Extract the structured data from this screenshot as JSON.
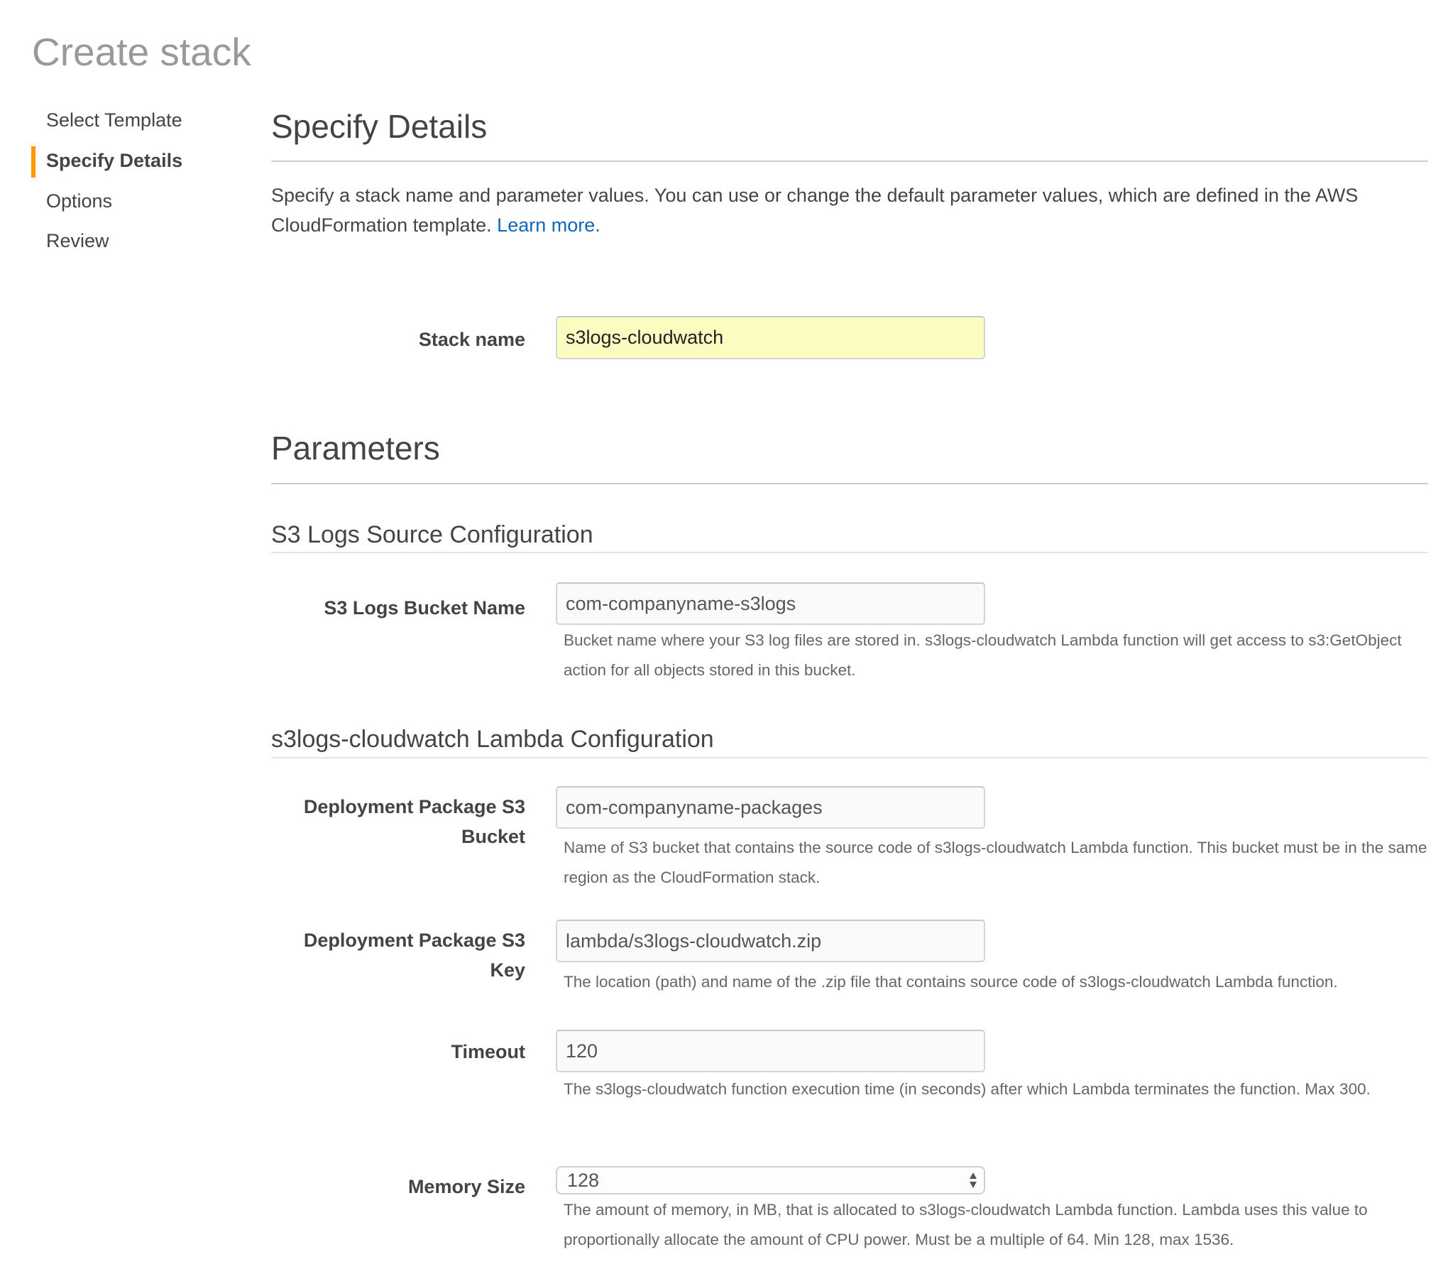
{
  "page": {
    "title": "Create stack"
  },
  "sidebar": {
    "items": [
      {
        "label": "Select Template",
        "active": false
      },
      {
        "label": "Specify Details",
        "active": true
      },
      {
        "label": "Options",
        "active": false
      },
      {
        "label": "Review",
        "active": false
      }
    ],
    "accent_color": "#ff9900"
  },
  "details": {
    "heading": "Specify Details",
    "intro": "Specify a stack name and parameter values. You can use or change the default parameter values, which are defined in the AWS CloudFormation template.",
    "learn_more": "Learn more.",
    "link_color": "#1166bb"
  },
  "stack": {
    "label": "Stack name",
    "value": "s3logs-cloudwatch"
  },
  "parameters": {
    "heading": "Parameters",
    "groups": [
      {
        "heading": "S3 Logs Source Configuration",
        "fields": [
          {
            "label": "S3 Logs Bucket Name",
            "value": "com-companyname-s3logs",
            "help": "Bucket name where your S3 log files are stored in. s3logs-cloudwatch Lambda function will get access to s3:GetObject action for all objects stored in this bucket."
          }
        ]
      },
      {
        "heading": "s3logs-cloudwatch Lambda Configuration",
        "fields": [
          {
            "label": "Deployment Package S3 Bucket",
            "value": "com-companyname-packages",
            "help": "Name of S3 bucket that contains the source code of s3logs-cloudwatch Lambda function. This bucket must be in the same region as the CloudFormation stack."
          },
          {
            "label": "Deployment Package S3 Key",
            "value": "lambda/s3logs-cloudwatch.zip",
            "help": "The location (path) and name of the .zip file that contains source code of s3logs-cloudwatch Lambda function."
          },
          {
            "label": "Timeout",
            "value": "120",
            "help": "The s3logs-cloudwatch function execution time (in seconds) after which Lambda terminates the function. Max 300."
          },
          {
            "label": "Memory Size",
            "value": "128",
            "control": "select",
            "help": "The amount of memory, in MB, that is allocated to s3logs-cloudwatch Lambda function. Lambda uses this value to proportionally allocate the amount of CPU power. Must be a multiple of 64. Min 128, max 1536."
          }
        ]
      }
    ]
  }
}
